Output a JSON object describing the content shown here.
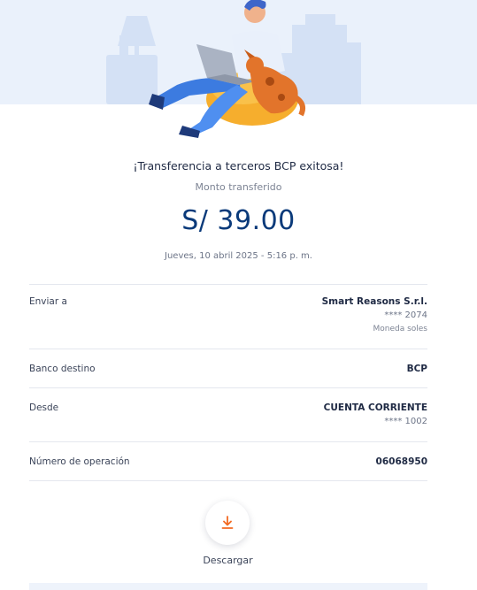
{
  "header": {
    "title": "¡Transferencia a terceros BCP exitosa!",
    "amount_label": "Monto transferido",
    "amount": "S/ 39.00",
    "date": "Jueves, 10 abril 2025 - 5:16 p. m."
  },
  "details": {
    "send_to": {
      "label": "Enviar a",
      "name": "Smart Reasons S.r.l.",
      "account": "**** 2074",
      "currency": "Moneda soles"
    },
    "bank": {
      "label": "Banco destino",
      "value": "BCP"
    },
    "from": {
      "label": "Desde",
      "value": "CUENTA CORRIENTE",
      "account": "**** 1002"
    },
    "operation": {
      "label": "Número de operación",
      "value": "06068950"
    }
  },
  "actions": {
    "download_label": "Descargar",
    "download_icon": "download-icon"
  },
  "colors": {
    "brand_blue": "#0a3a7a",
    "accent_orange": "#f26a22",
    "hero_bg": "#eaf1fb"
  }
}
